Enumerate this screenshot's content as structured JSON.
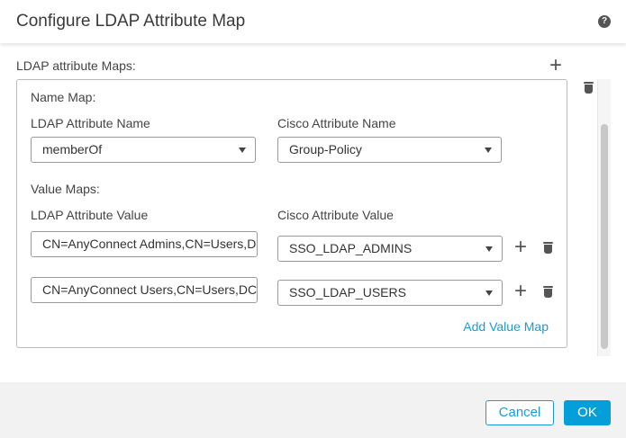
{
  "dialog": {
    "title": "Configure LDAP Attribute Map",
    "help": "?"
  },
  "maps_label": "LDAP attribute Maps:",
  "name_map": {
    "heading": "Name Map:",
    "ldap_label": "LDAP Attribute Name",
    "cisco_label": "Cisco Attribute Name",
    "ldap_value": "memberOf",
    "cisco_value": "Group-Policy"
  },
  "value_maps": {
    "heading": "Value Maps:",
    "ldap_label": "LDAP Attribute Value",
    "cisco_label": "Cisco Attribute Value",
    "rows": [
      {
        "ldap": "CN=AnyConnect Admins,CN=Users,DC=example",
        "cisco": "SSO_LDAP_ADMINS"
      },
      {
        "ldap": "CN=AnyConnect Users,CN=Users,DC=example",
        "cisco": "SSO_LDAP_USERS"
      }
    ],
    "add_label": "Add Value Map"
  },
  "footer": {
    "cancel": "Cancel",
    "ok": "OK"
  },
  "colors": {
    "accent": "#049fd9"
  }
}
